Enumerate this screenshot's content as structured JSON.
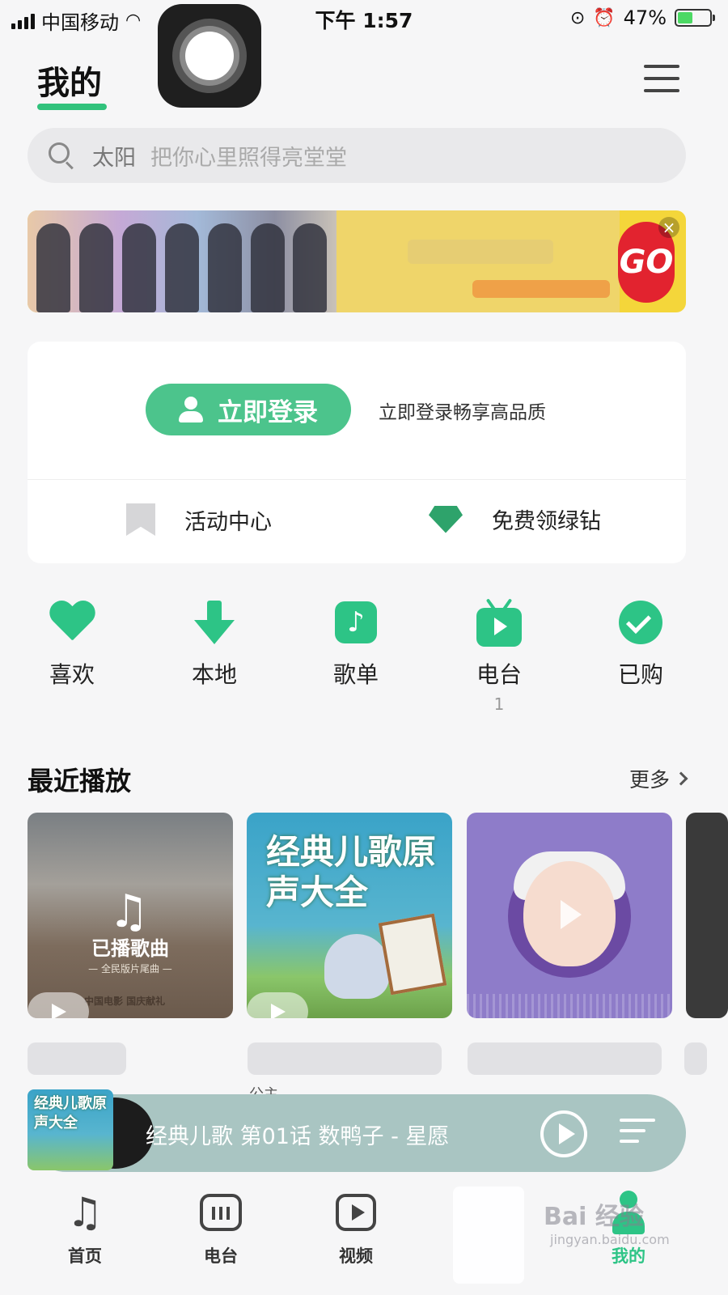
{
  "status_bar": {
    "carrier": "中国移动",
    "time": "下午 1:57",
    "battery_percent": "47%",
    "battery_level": 0.47
  },
  "header": {
    "title": "我的",
    "menu_icon": "menu-icon"
  },
  "search": {
    "keyword": "太阳",
    "placeholder": "把你心里照得亮堂堂"
  },
  "banner": {
    "badge_text": "GO",
    "close_icon": "close-icon"
  },
  "login_card": {
    "login_button_label": "立即登录",
    "login_hint": "立即登录畅享高品质",
    "activity_center_label": "活动中心",
    "free_diamond_label": "免费领绿钻"
  },
  "quick_actions": [
    {
      "label": "喜欢",
      "icon": "heart-icon"
    },
    {
      "label": "本地",
      "icon": "download-icon"
    },
    {
      "label": "歌单",
      "icon": "playlist-icon"
    },
    {
      "label": "电台",
      "icon": "radio-icon",
      "count": "1"
    },
    {
      "label": "已购",
      "icon": "check-circle-icon"
    }
  ],
  "recent": {
    "title": "最近播放",
    "more_label": "更多",
    "covers": [
      {
        "overlay_label": "已播歌曲",
        "subtitle": "— 全民版片尾曲 —",
        "footer": "中国电影 国庆献礼"
      },
      {
        "title": "经典儿歌原声大全"
      },
      {
        "icon": "play-icon"
      }
    ],
    "caption_fragment": "公主"
  },
  "mini_player": {
    "cover_title": "经典儿歌原声大全",
    "track": "经典儿歌 第01话 数鸭子 - 星愿"
  },
  "tab_bar": {
    "tabs": [
      {
        "label": "首页",
        "icon": "music-note-icon"
      },
      {
        "label": "电台",
        "icon": "radio-tv-icon"
      },
      {
        "label": "视频",
        "icon": "video-play-icon"
      },
      {
        "label": "我的",
        "icon": "user-icon",
        "active": true
      }
    ]
  },
  "watermark": {
    "text": "Bai 经验",
    "sub": "jingyan.baidu.com"
  },
  "colors": {
    "accent": "#2dc486",
    "login_button": "#4cc48c",
    "mini_player_bg": "#a9c5c2"
  }
}
